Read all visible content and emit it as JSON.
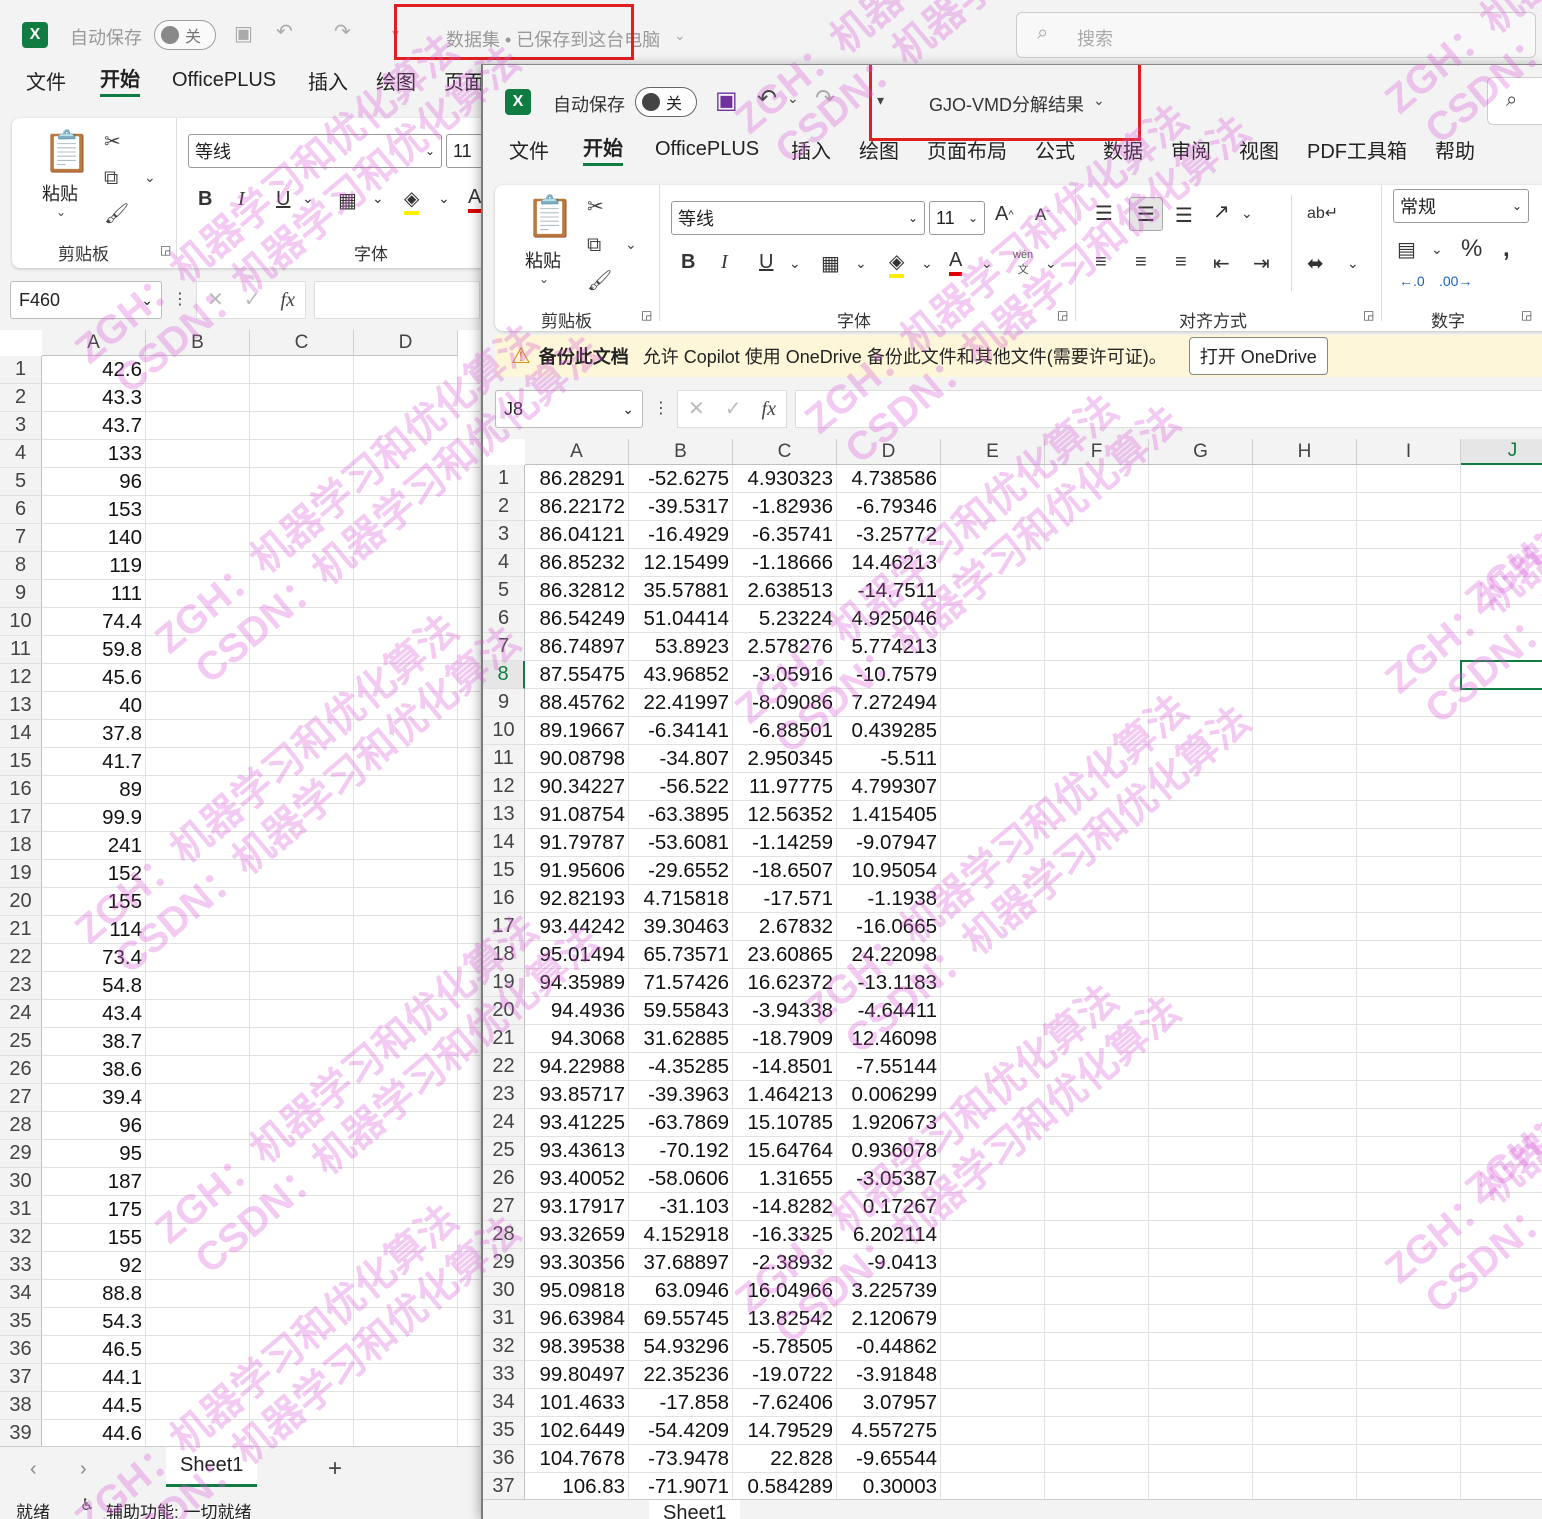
{
  "back": {
    "autosave_label": "自动保存",
    "autosave_state": "关",
    "doc_title": "数据集 • 已保存到这台电脑",
    "search_placeholder": "搜索",
    "tabs": [
      "文件",
      "开始",
      "OfficePLUS",
      "插入",
      "绘图",
      "页面"
    ],
    "paste_label": "粘贴",
    "clipboard_group": "剪贴板",
    "font_name": "等线",
    "font_size": "11",
    "font_group": "字体",
    "name_box": "F460",
    "columns": [
      "A",
      "B",
      "C",
      "D"
    ],
    "rows": [
      "1",
      "2",
      "3",
      "4",
      "5",
      "6",
      "7",
      "8",
      "9",
      "10",
      "11",
      "12",
      "13",
      "14",
      "15",
      "16",
      "17",
      "18",
      "19",
      "20",
      "21",
      "22",
      "23",
      "24",
      "25",
      "26",
      "27",
      "28",
      "29",
      "30",
      "31",
      "32",
      "33",
      "34",
      "35",
      "36",
      "37",
      "38",
      "39"
    ],
    "col_a_values": [
      "42.6",
      "43.3",
      "43.7",
      "133",
      "96",
      "153",
      "140",
      "119",
      "111",
      "74.4",
      "59.8",
      "45.6",
      "40",
      "37.8",
      "41.7",
      "89",
      "99.9",
      "241",
      "152",
      "155",
      "114",
      "73.4",
      "54.8",
      "43.4",
      "38.7",
      "38.6",
      "39.4",
      "96",
      "95",
      "187",
      "175",
      "155",
      "92",
      "88.8",
      "54.3",
      "46.5",
      "44.1",
      "44.5",
      "44.6"
    ],
    "sheet_tab": "Sheet1",
    "status_ready": "就绪",
    "status_accessibility": "辅助功能: 一切就绪"
  },
  "front": {
    "autosave_label": "自动保存",
    "autosave_state": "关",
    "doc_title": "GJO-VMD分解结果",
    "tabs": [
      "文件",
      "开始",
      "OfficePLUS",
      "插入",
      "绘图",
      "页面布局",
      "公式",
      "数据",
      "审阅",
      "视图",
      "PDF工具箱",
      "帮助"
    ],
    "paste_label": "粘贴",
    "clipboard_group": "剪贴板",
    "font_name": "等线",
    "font_size": "11",
    "font_group": "字体",
    "align_group": "对齐方式",
    "number_format": "常规",
    "number_group": "数字",
    "phonetic_label": "wén",
    "banner_title": "备份此文档",
    "banner_text": "允许 Copilot 使用 OneDrive 备份此文件和其他文件(需要许可证)。",
    "banner_button": "打开 OneDrive",
    "name_box": "J8",
    "columns": [
      "A",
      "B",
      "C",
      "D",
      "E",
      "F",
      "G",
      "H",
      "I",
      "J"
    ],
    "rows": [
      "1",
      "2",
      "3",
      "4",
      "5",
      "6",
      "7",
      "8",
      "9",
      "10",
      "11",
      "12",
      "13",
      "14",
      "15",
      "16",
      "17",
      "18",
      "19",
      "20",
      "21",
      "22",
      "23",
      "24",
      "25",
      "26",
      "27",
      "28",
      "29",
      "30",
      "31",
      "32",
      "33",
      "34",
      "35",
      "36",
      "37"
    ],
    "data": [
      [
        "86.28291",
        "-52.6275",
        "4.930323",
        "4.738586"
      ],
      [
        "86.22172",
        "-39.5317",
        "-1.82936",
        "-6.79346"
      ],
      [
        "86.04121",
        "-16.4929",
        "-6.35741",
        "-3.25772"
      ],
      [
        "86.85232",
        "12.15499",
        "-1.18666",
        "14.46213"
      ],
      [
        "86.32812",
        "35.57881",
        "2.638513",
        "-14.7511"
      ],
      [
        "86.54249",
        "51.04414",
        "5.23224",
        "4.925046"
      ],
      [
        "86.74897",
        "53.8923",
        "2.578276",
        "5.774213"
      ],
      [
        "87.55475",
        "43.96852",
        "-3.05916",
        "-10.7579"
      ],
      [
        "88.45762",
        "22.41997",
        "-8.09086",
        "7.272494"
      ],
      [
        "89.19667",
        "-6.34141",
        "-6.88501",
        "0.439285"
      ],
      [
        "90.08798",
        "-34.807",
        "2.950345",
        "-5.511"
      ],
      [
        "90.34227",
        "-56.522",
        "11.97775",
        "4.799307"
      ],
      [
        "91.08754",
        "-63.3895",
        "12.56352",
        "1.415405"
      ],
      [
        "91.79787",
        "-53.6081",
        "-1.14259",
        "-9.07947"
      ],
      [
        "91.95606",
        "-29.6552",
        "-18.6507",
        "10.95054"
      ],
      [
        "92.82193",
        "4.715818",
        "-17.571",
        "-1.1938"
      ],
      [
        "93.44242",
        "39.30463",
        "2.67832",
        "-16.0665"
      ],
      [
        "95.01494",
        "65.73571",
        "23.60865",
        "24.22098"
      ],
      [
        "94.35989",
        "71.57426",
        "16.62372",
        "-13.1183"
      ],
      [
        "94.4936",
        "59.55843",
        "-3.94338",
        "-4.64411"
      ],
      [
        "94.3068",
        "31.62885",
        "-18.7909",
        "12.46098"
      ],
      [
        "94.22988",
        "-4.35285",
        "-14.8501",
        "-7.55144"
      ],
      [
        "93.85717",
        "-39.3963",
        "1.464213",
        "0.006299"
      ],
      [
        "93.41225",
        "-63.7869",
        "15.10785",
        "1.920673"
      ],
      [
        "93.43613",
        "-70.192",
        "15.64764",
        "0.936078"
      ],
      [
        "93.40052",
        "-58.0606",
        "1.31655",
        "-3.05387"
      ],
      [
        "93.17917",
        "-31.103",
        "-14.8282",
        "0.17267"
      ],
      [
        "93.32659",
        "4.152918",
        "-16.3325",
        "6.202114"
      ],
      [
        "93.30356",
        "37.68897",
        "-2.38932",
        "-9.0413"
      ],
      [
        "95.09818",
        "63.0946",
        "16.04966",
        "3.225739"
      ],
      [
        "96.63984",
        "69.55745",
        "13.82542",
        "2.120679"
      ],
      [
        "98.39538",
        "54.93296",
        "-5.78505",
        "-0.44862"
      ],
      [
        "99.80497",
        "22.35236",
        "-19.0722",
        "-3.91848"
      ],
      [
        "101.4633",
        "-17.858",
        "-7.62406",
        "3.07957"
      ],
      [
        "102.6449",
        "-54.4209",
        "14.79529",
        "4.557275"
      ],
      [
        "104.7678",
        "-73.9478",
        "22.828",
        "-9.65544"
      ],
      [
        "106.83",
        "-71.9071",
        "0.584289",
        "0.30003"
      ]
    ],
    "sheet_tab": "Sheet1"
  },
  "watermarks": [
    "ZGH：机器学习和优化算法",
    "CSDN：机器学习和优化算法"
  ],
  "colors": {
    "excel_green": "#107c41",
    "highlight_red": "#e02020",
    "watermark": "#d85ad8",
    "banner_bg": "#fdf6d8"
  }
}
